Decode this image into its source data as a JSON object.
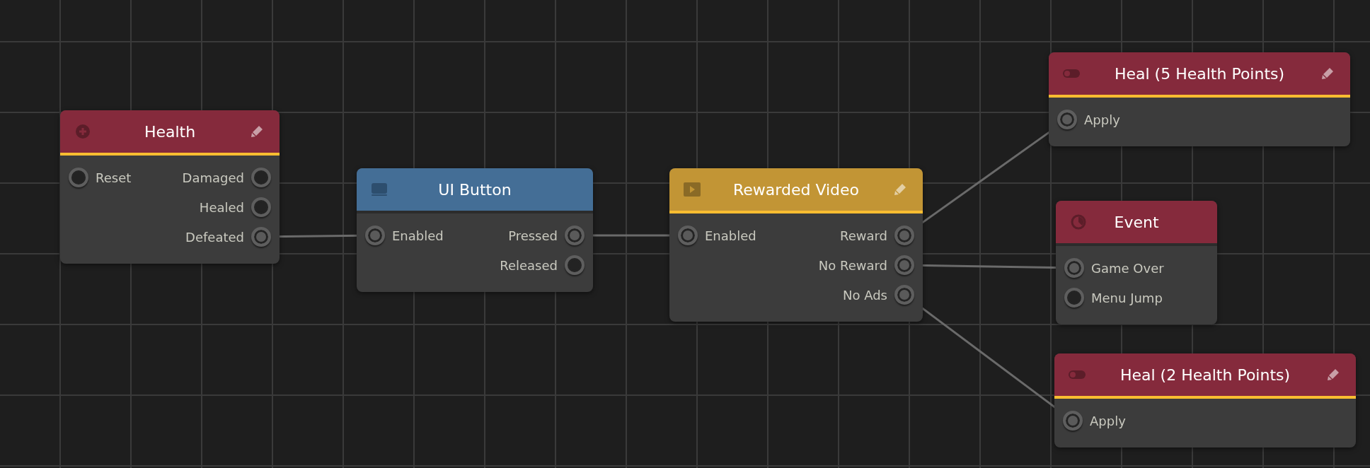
{
  "nodes": [
    {
      "title": "Health",
      "kind": "health",
      "color": "#852a3c",
      "editable": true,
      "underlined": true,
      "inputs": [
        {
          "label": "Reset",
          "connected": false
        }
      ],
      "outputs": [
        {
          "label": "Damaged",
          "connected": false
        },
        {
          "label": "Healed",
          "connected": false
        },
        {
          "label": "Defeated",
          "connected": true
        }
      ]
    },
    {
      "title": "UI Button",
      "kind": "button",
      "color": "#446e96",
      "editable": false,
      "underlined": false,
      "inputs": [
        {
          "label": "Enabled",
          "connected": true
        }
      ],
      "outputs": [
        {
          "label": "Pressed",
          "connected": true
        },
        {
          "label": "Released",
          "connected": false
        }
      ]
    },
    {
      "title": "Rewarded Video",
      "kind": "video",
      "color": "#c29535",
      "editable": true,
      "underlined": true,
      "inputs": [
        {
          "label": "Enabled",
          "connected": true
        }
      ],
      "outputs": [
        {
          "label": "Reward",
          "connected": true
        },
        {
          "label": "No Reward",
          "connected": true
        },
        {
          "label": "No Ads",
          "connected": true
        }
      ]
    },
    {
      "title": "Heal (5 Health Points)",
      "kind": "toggle",
      "color": "#852a3c",
      "editable": true,
      "underlined": true,
      "inputs": [
        {
          "label": "Apply",
          "connected": true
        }
      ]
    },
    {
      "title": "Event",
      "kind": "event",
      "color": "#852a3c",
      "editable": false,
      "underlined": false,
      "inputs": [
        {
          "label": "Game Over",
          "connected": true
        },
        {
          "label": "Menu Jump",
          "connected": false
        }
      ]
    },
    {
      "title": "Heal (2 Health Points)",
      "kind": "toggle",
      "color": "#852a3c",
      "editable": true,
      "underlined": true,
      "inputs": [
        {
          "label": "Apply",
          "connected": true
        }
      ]
    }
  ]
}
